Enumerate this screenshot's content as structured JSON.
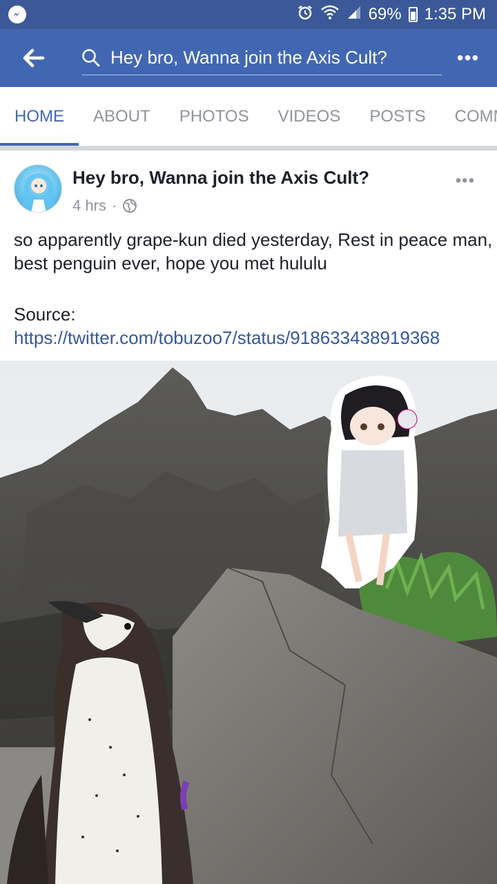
{
  "status_bar": {
    "battery": "69%",
    "time": "1:35 PM"
  },
  "header": {
    "search_text": "Hey bro, Wanna join the Axis Cult?",
    "more": "•••"
  },
  "tabs": [
    {
      "label": "HOME",
      "active": true
    },
    {
      "label": "ABOUT"
    },
    {
      "label": "PHOTOS"
    },
    {
      "label": "VIDEOS"
    },
    {
      "label": "POSTS"
    },
    {
      "label": "COMMUNITY"
    }
  ],
  "post": {
    "page_name": "Hey bro, Wanna join the Axis Cult?",
    "time_ago": "4 hrs",
    "separator": "·",
    "more": "•••",
    "text": "so apparently grape-kun died yesterday, Rest in peace man, best penguin ever, hope you met hululu",
    "source_label": "Source:",
    "source_link": "https://twitter.com/tobuzoo7/status/918633438919368"
  },
  "colors": {
    "status_bar": "#3b5998",
    "header": "#4267b2",
    "link": "#365899",
    "inactive_tab": "#90949c"
  }
}
